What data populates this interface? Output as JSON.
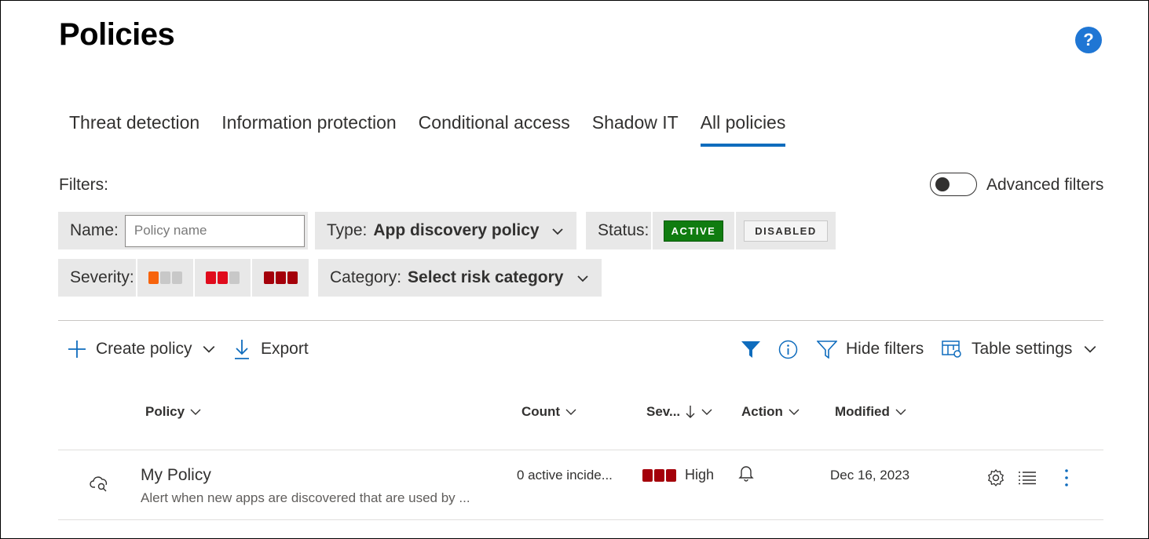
{
  "header": {
    "title": "Policies",
    "help_icon": "help-circle-icon",
    "help_label": "?"
  },
  "tabs": [
    {
      "label": "Threat detection",
      "active": false
    },
    {
      "label": "Information protection",
      "active": false
    },
    {
      "label": "Conditional access",
      "active": false
    },
    {
      "label": "Shadow IT",
      "active": false
    },
    {
      "label": "All policies",
      "active": true
    }
  ],
  "filters": {
    "label": "Filters:",
    "advanced_label": "Advanced filters",
    "advanced_on": false,
    "name": {
      "label": "Name:",
      "value": "",
      "placeholder": "Policy name"
    },
    "type": {
      "label": "Type:",
      "value": "App discovery policy"
    },
    "status": {
      "label": "Status:",
      "active_label": "ACTIVE",
      "disabled_label": "DISABLED",
      "selected": "ACTIVE"
    },
    "severity": {
      "label": "Severity:",
      "levels": [
        {
          "level": "low",
          "filled": 1
        },
        {
          "level": "medium",
          "filled": 2
        },
        {
          "level": "high",
          "filled": 3
        }
      ]
    },
    "category": {
      "label": "Category:",
      "value": "Select risk category"
    }
  },
  "toolbar": {
    "create_label": "Create policy",
    "export_label": "Export",
    "hide_filters_label": "Hide filters",
    "table_settings_label": "Table settings"
  },
  "table": {
    "columns": {
      "policy": "Policy",
      "count": "Count",
      "severity": "Sev...",
      "action": "Action",
      "modified": "Modified"
    },
    "rows": [
      {
        "icon": "cloud-search-icon",
        "name": "My Policy",
        "description": "Alert when new apps are discovered that are used by ...",
        "count": "0 active incide...",
        "severity": "High",
        "action_icon": "bell-icon",
        "modified": "Dec 16, 2023"
      }
    ]
  },
  "colors": {
    "accent": "#0f6cbd",
    "active_green": "#107c10",
    "sev_low": "#f7630c",
    "sev_medium": "#e00b1c",
    "sev_high": "#a4000a",
    "sev_empty": "#c8c8c8"
  }
}
